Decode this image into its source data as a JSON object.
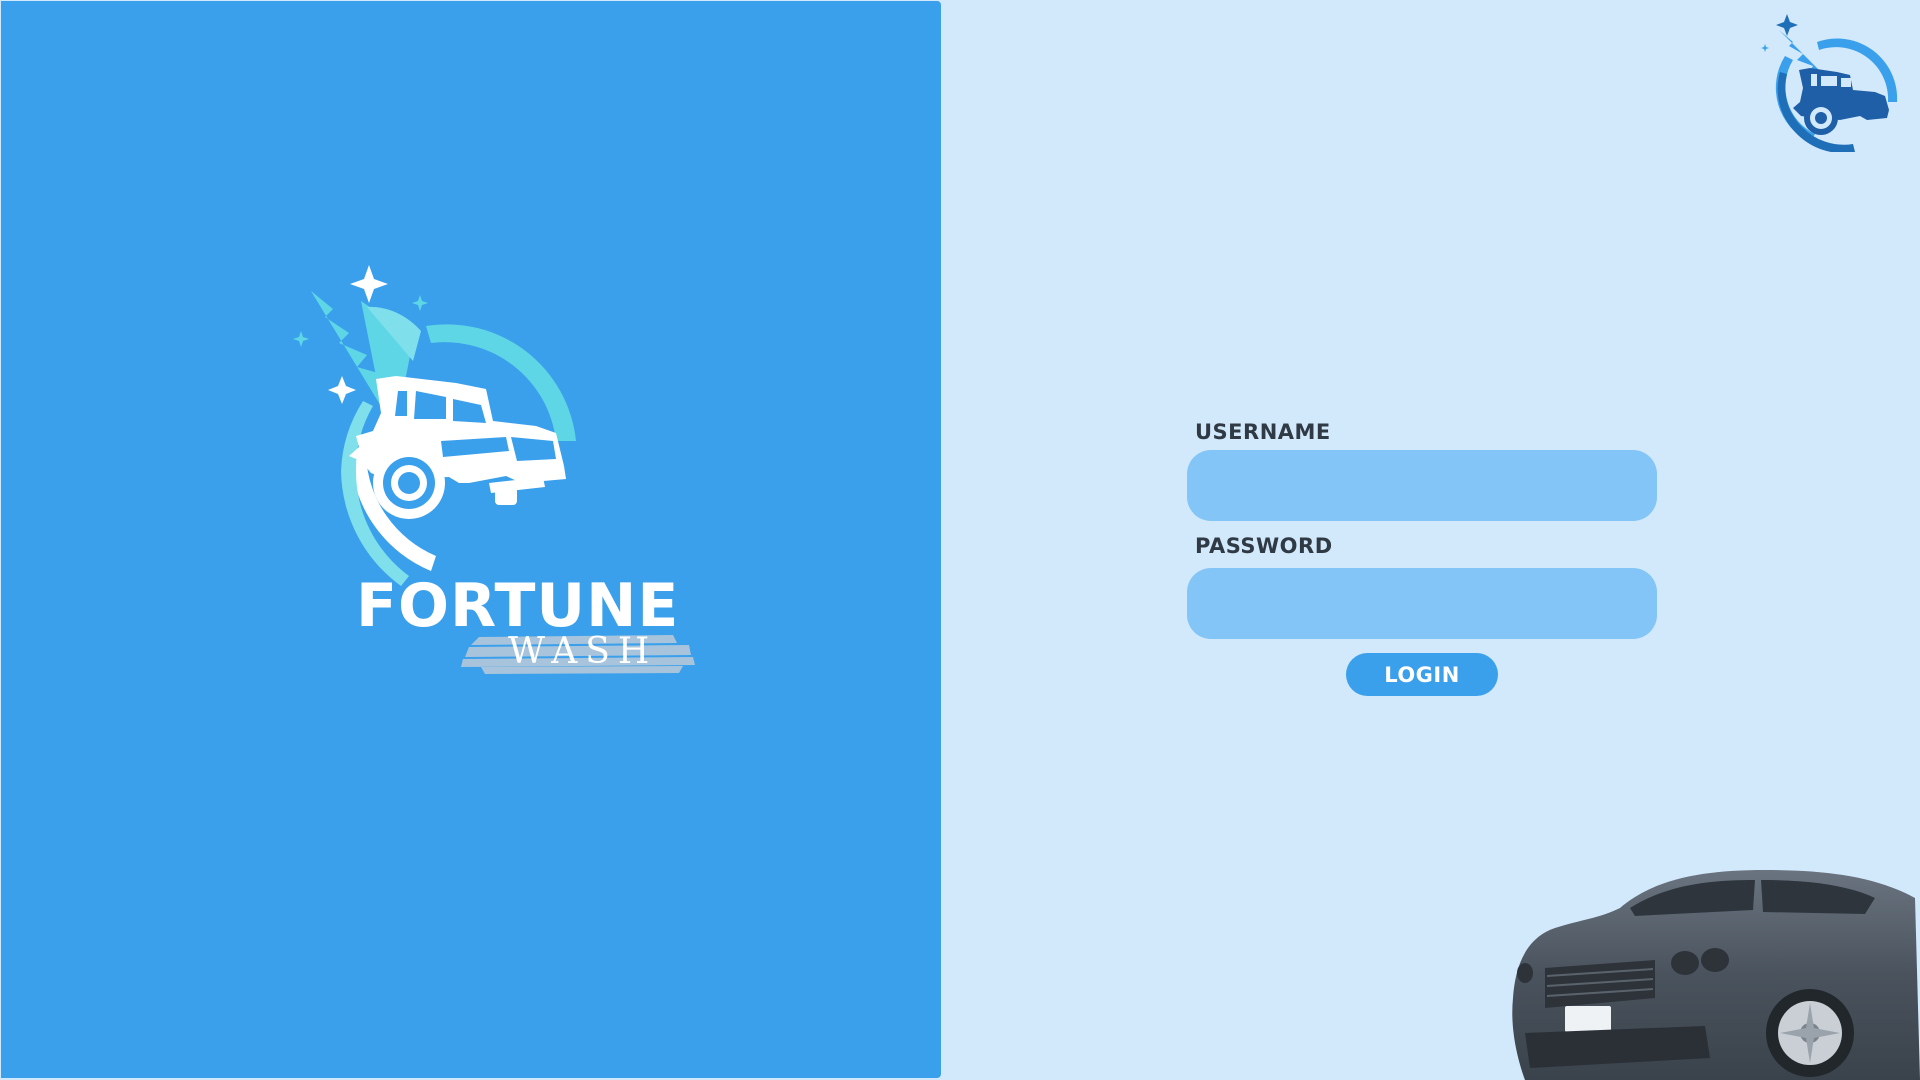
{
  "brand": {
    "name": "FORTUNE",
    "subtitle": "WASH"
  },
  "login": {
    "username_label": "USERNAME",
    "username_value": "",
    "password_label": "PASSWORD",
    "password_value": "",
    "button_label": "LOGIN"
  },
  "icons": {
    "brand_logo": "truck-car-wash-logo",
    "corner_logo": "truck-car-wash-logo",
    "car_image": "sedan-car-illustration"
  },
  "colors": {
    "left_panel": "#3aa0ec",
    "page_background": "#d2e8fb",
    "input_fill": "#83c5f6",
    "button_fill": "#3aa0ec",
    "label_text": "#2f3a44",
    "logo_accent": "#5fd6e6"
  }
}
